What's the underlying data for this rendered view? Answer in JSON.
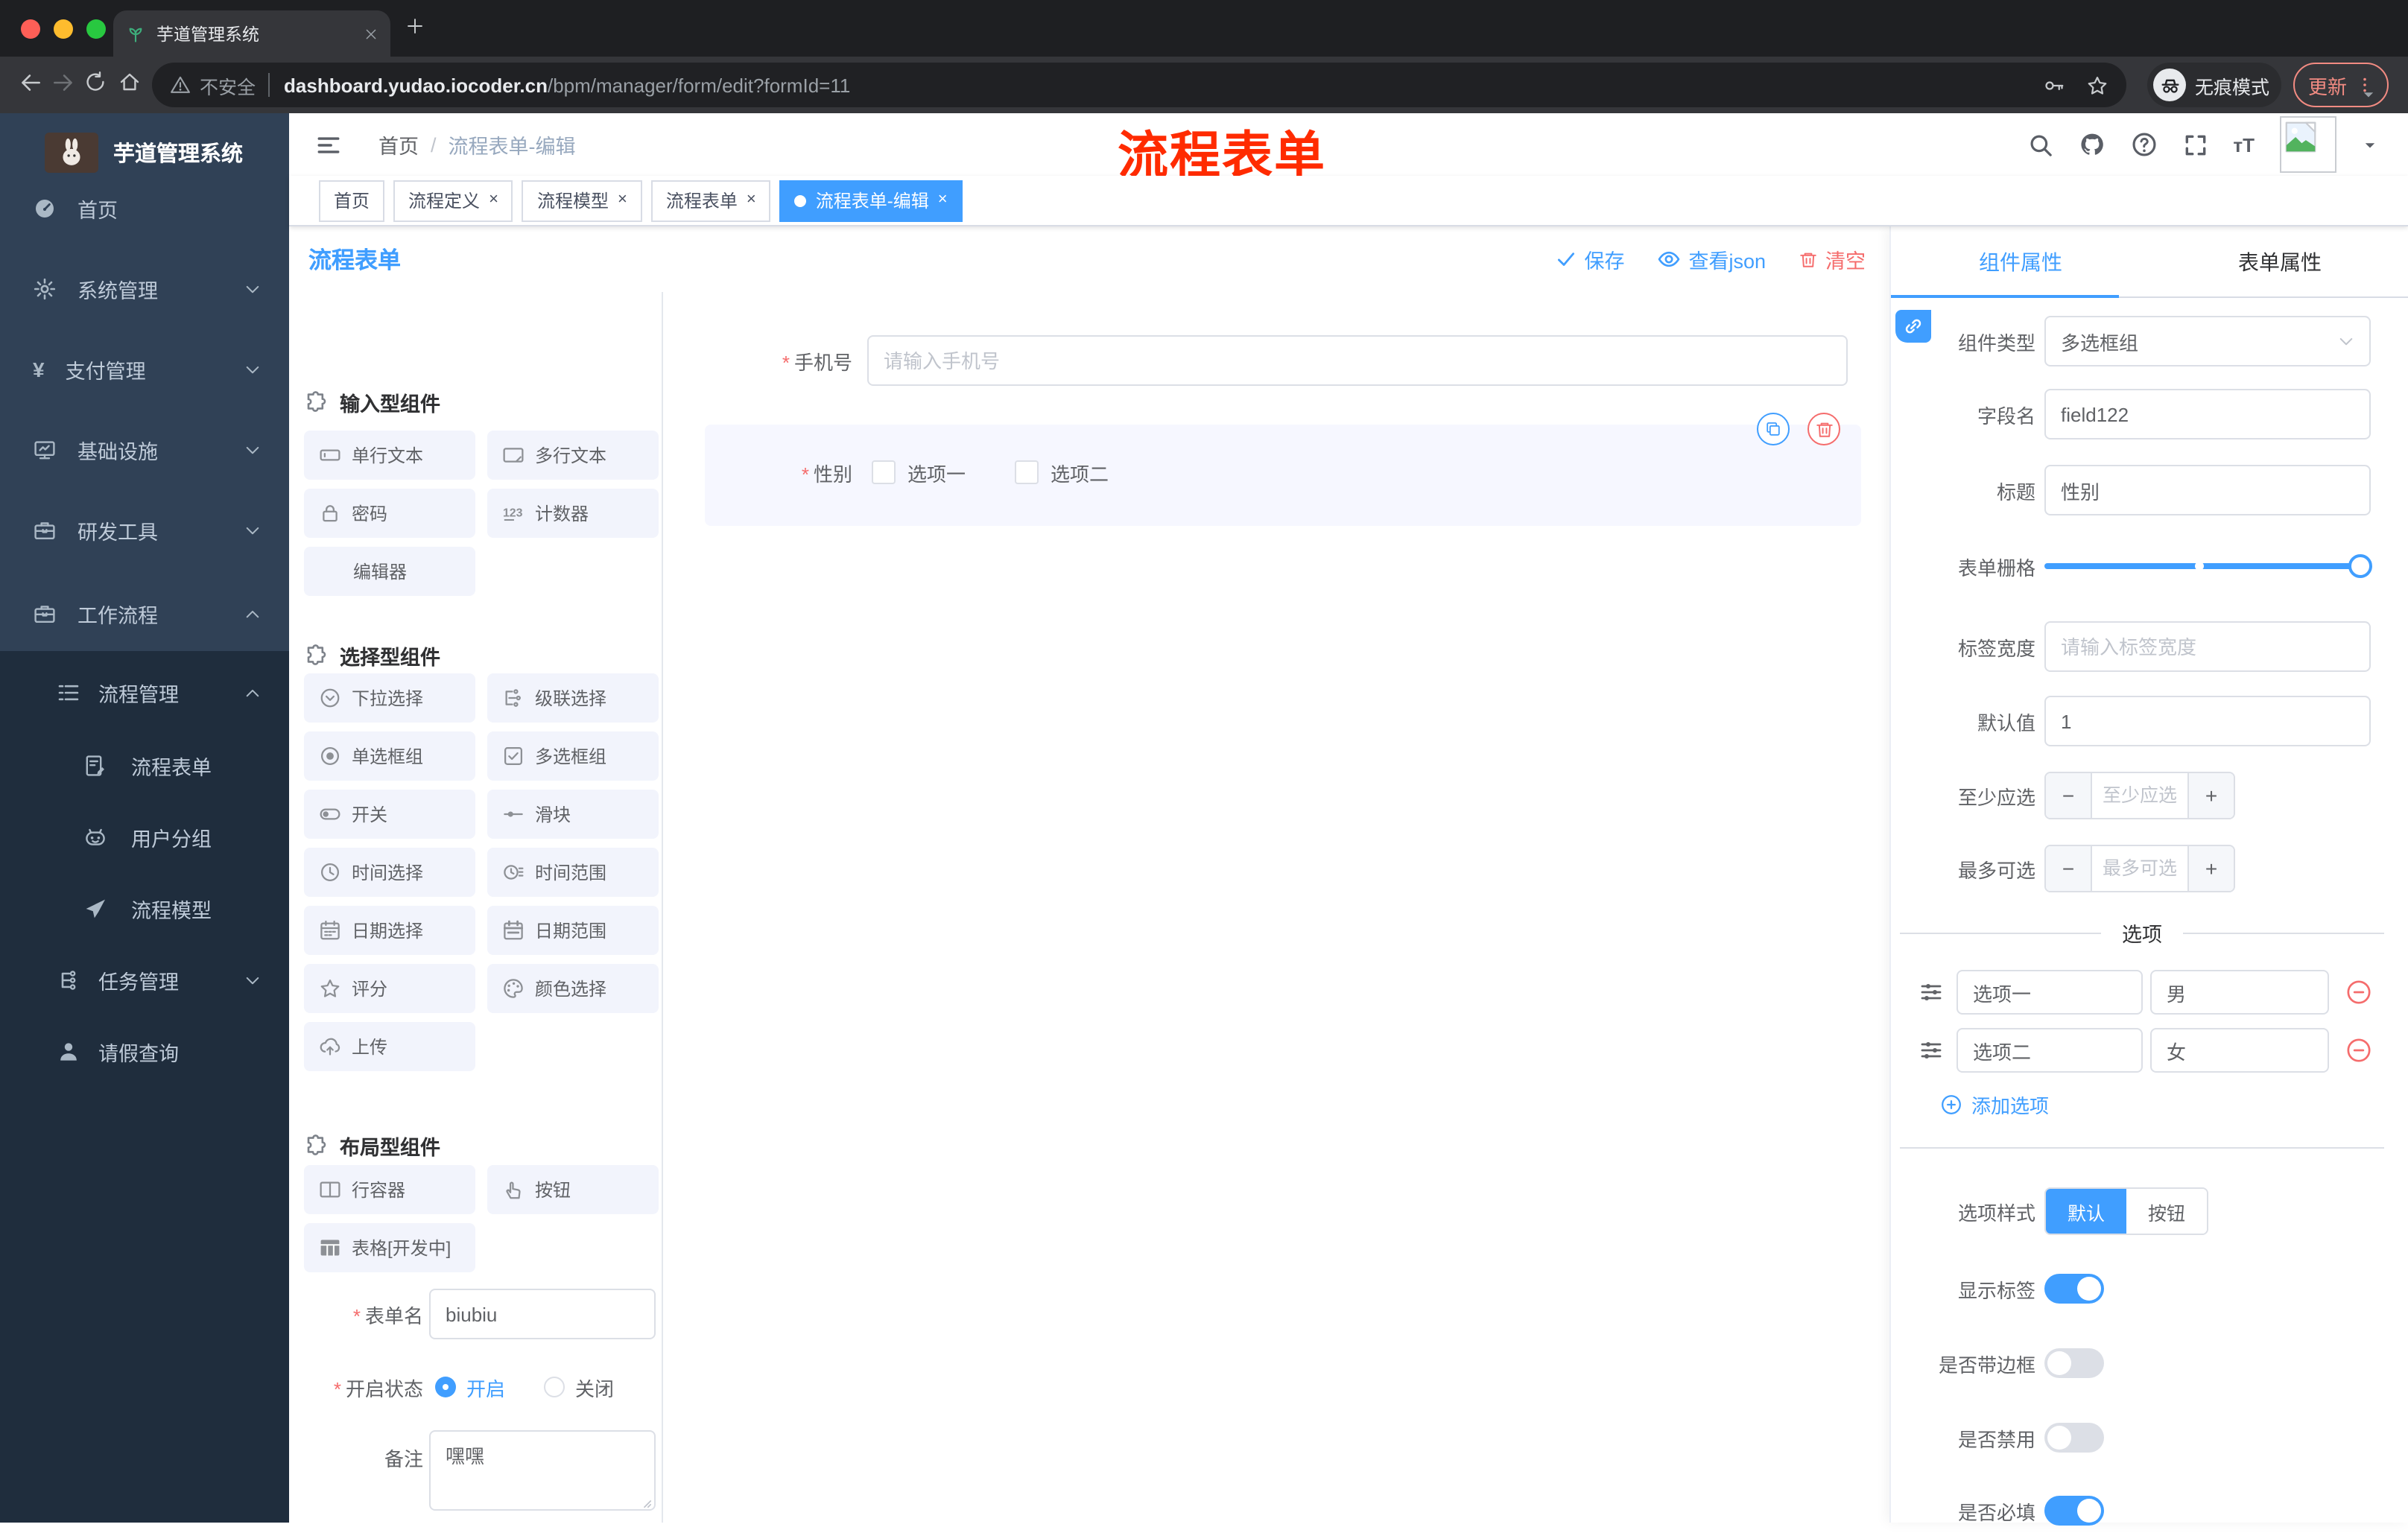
{
  "colors": {
    "accent": "#409EFF",
    "danger": "#F56C6C",
    "annotation_red": "#FF2B00",
    "sidebar_bg": "#304156",
    "submenu_bg": "#1F2D3D"
  },
  "browser": {
    "tab_title": "芋道管理系统",
    "security_label": "不安全",
    "url_domain": "dashboard.yudao.iocoder.cn",
    "url_path": "/bpm/manager/form/edit?formId=11",
    "incognito_label": "无痕模式",
    "update_label": "更新"
  },
  "header": {
    "breadcrumb_home": "首页",
    "breadcrumb_current": "流程表单-编辑",
    "annotation": "流程表单"
  },
  "tags": [
    {
      "label": "首页",
      "closable": false,
      "active": false
    },
    {
      "label": "流程定义",
      "closable": true,
      "active": false
    },
    {
      "label": "流程模型",
      "closable": true,
      "active": false
    },
    {
      "label": "流程表单",
      "closable": true,
      "active": false
    },
    {
      "label": "流程表单-编辑",
      "closable": true,
      "active": true
    }
  ],
  "sidebar": {
    "logo_title": "芋道管理系统",
    "items": [
      {
        "key": "home",
        "label": "首页",
        "icon": "gauge",
        "chevron": null
      },
      {
        "key": "system",
        "label": "系统管理",
        "icon": "gear",
        "chevron": "down"
      },
      {
        "key": "payment",
        "label": "支付管理",
        "icon": "yen",
        "chevron": "down"
      },
      {
        "key": "infra",
        "label": "基础设施",
        "icon": "monitor",
        "chevron": "down"
      },
      {
        "key": "devtools",
        "label": "研发工具",
        "icon": "briefcase",
        "chevron": "down"
      },
      {
        "key": "workflow",
        "label": "工作流程",
        "icon": "briefcase",
        "chevron": "up"
      }
    ],
    "submenu": [
      {
        "key": "process-manage",
        "label": "流程管理",
        "icon": "list",
        "chevron": "up",
        "indent": 1
      },
      {
        "key": "process-form",
        "label": "流程表单",
        "icon": "doc-edit",
        "chevron": null,
        "indent": 2
      },
      {
        "key": "user-group",
        "label": "用户分组",
        "icon": "robot",
        "chevron": null,
        "indent": 2
      },
      {
        "key": "process-model",
        "label": "流程模型",
        "icon": "plane",
        "chevron": null,
        "indent": 2
      },
      {
        "key": "task-manage",
        "label": "任务管理",
        "icon": "tree",
        "chevron": "down",
        "indent": 1
      },
      {
        "key": "leave-query",
        "label": "请假查询",
        "icon": "person",
        "chevron": null,
        "indent": 1
      }
    ]
  },
  "builder": {
    "title": "流程表单",
    "actions": {
      "save": "保存",
      "view_json": "查看json",
      "clear": "清空"
    },
    "groups": [
      {
        "title": "输入型组件",
        "items": [
          {
            "label": "单行文本",
            "icon": "input"
          },
          {
            "label": "多行文本",
            "icon": "textarea"
          },
          {
            "label": "密码",
            "icon": "lock"
          },
          {
            "label": "计数器",
            "icon": "counter"
          },
          {
            "label": "编辑器",
            "icon": "none"
          }
        ]
      },
      {
        "title": "选择型组件",
        "items": [
          {
            "label": "下拉选择",
            "icon": "select"
          },
          {
            "label": "级联选择",
            "icon": "cascader"
          },
          {
            "label": "单选框组",
            "icon": "radio"
          },
          {
            "label": "多选框组",
            "icon": "checkbox"
          },
          {
            "label": "开关",
            "icon": "switch"
          },
          {
            "label": "滑块",
            "icon": "slider"
          },
          {
            "label": "时间选择",
            "icon": "time"
          },
          {
            "label": "时间范围",
            "icon": "time-range"
          },
          {
            "label": "日期选择",
            "icon": "date"
          },
          {
            "label": "日期范围",
            "icon": "date-range"
          },
          {
            "label": "评分",
            "icon": "rate"
          },
          {
            "label": "颜色选择",
            "icon": "color"
          },
          {
            "label": "上传",
            "icon": "upload"
          }
        ]
      },
      {
        "title": "布局型组件",
        "items": [
          {
            "label": "行容器",
            "icon": "rowbox"
          },
          {
            "label": "按钮",
            "icon": "hand"
          },
          {
            "label": "表格[开发中]",
            "icon": "tablegrid"
          }
        ]
      }
    ],
    "form": {
      "name_label": "表单名",
      "name_value": "biubiu",
      "status_label": "开启状态",
      "status_on": "开启",
      "status_off": "关闭",
      "status_selected": "开启",
      "remark_label": "备注",
      "remark_value": "嘿嘿"
    }
  },
  "canvas": {
    "phone": {
      "label": "手机号",
      "required": true,
      "placeholder": "请输入手机号"
    },
    "gender": {
      "label": "性别",
      "required": true,
      "options": [
        "选项一",
        "选项二"
      ],
      "selected": true
    }
  },
  "panel": {
    "tabs": [
      "组件属性",
      "表单属性"
    ],
    "active_tab": "组件属性",
    "component_type": {
      "label": "组件类型",
      "value": "多选框组"
    },
    "field_name": {
      "label": "字段名",
      "value": "field122"
    },
    "title": {
      "label": "标题",
      "value": "性别"
    },
    "grid": {
      "label": "表单栅格"
    },
    "label_width": {
      "label": "标签宽度",
      "placeholder": "请输入标签宽度"
    },
    "default_value": {
      "label": "默认值",
      "value": "1"
    },
    "min_select": {
      "label": "至少应选",
      "placeholder": "至少应选"
    },
    "max_select": {
      "label": "最多可选",
      "placeholder": "最多可选"
    },
    "options_title": "选项",
    "options": [
      {
        "text": "选项一",
        "value": "男"
      },
      {
        "text": "选项二",
        "value": "女"
      }
    ],
    "add_option_label": "添加选项",
    "option_style": {
      "label": "选项样式",
      "choices": [
        "默认",
        "按钮"
      ],
      "active": "默认"
    },
    "switches": [
      {
        "label": "显示标签",
        "on": true
      },
      {
        "label": "是否带边框",
        "on": false
      },
      {
        "label": "是否禁用",
        "on": false
      },
      {
        "label": "是否必填",
        "on": true
      }
    ]
  }
}
